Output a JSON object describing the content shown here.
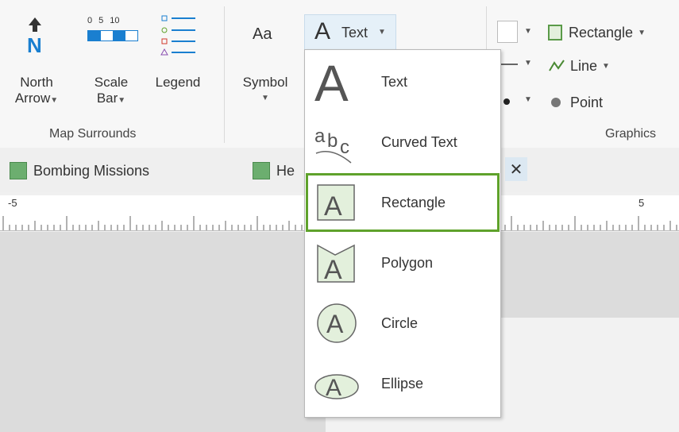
{
  "ribbon": {
    "north_arrow": {
      "line1": "North",
      "line2": "Arrow"
    },
    "scale_bar": {
      "line1": "Scale",
      "line2": "Bar",
      "ticks": [
        "0",
        "5",
        "10"
      ]
    },
    "legend": {
      "label": "Legend"
    },
    "symbol": {
      "label": "Symbol",
      "glyph": "Aa"
    },
    "group_map_surrounds": "Map Surrounds",
    "text_button": {
      "glyph": "A",
      "label": "Text"
    },
    "graphics": {
      "rectangle": "Rectangle",
      "line": "Line",
      "point": "Point",
      "group_label": "Graphics"
    }
  },
  "tabs": [
    {
      "label": "Bombing Missions"
    },
    {
      "label": "He"
    }
  ],
  "ruler": {
    "left_label": "-5",
    "right_label": "5"
  },
  "text_menu": {
    "items": [
      {
        "label": "Text",
        "icon": "large-text-icon"
      },
      {
        "label": "Curved Text",
        "icon": "curved-text-icon"
      },
      {
        "label": "Rectangle",
        "icon": "rectangle-text-icon",
        "selected": true
      },
      {
        "label": "Polygon",
        "icon": "polygon-text-icon"
      },
      {
        "label": "Circle",
        "icon": "circle-text-icon"
      },
      {
        "label": "Ellipse",
        "icon": "ellipse-text-icon"
      }
    ]
  },
  "colors": {
    "highlight": "#5fa22b",
    "north_arrow": "#1a7fd0",
    "map_icon": "#6cae6f"
  }
}
